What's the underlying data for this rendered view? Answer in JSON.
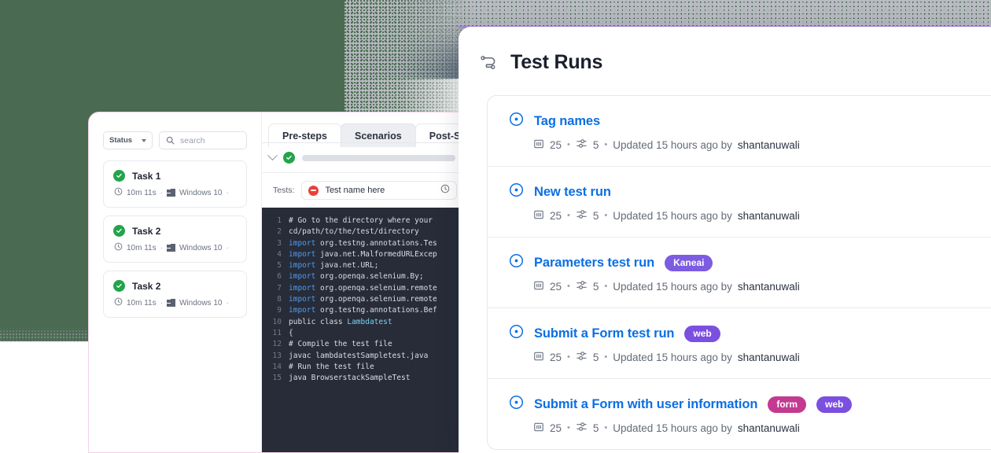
{
  "background": {
    "green": "#4a6b52",
    "slate": "#5d6a7d",
    "pink_line": "#f5cfe6",
    "purple_line": "#a78bd8"
  },
  "left_panel": {
    "filters": {
      "status_label": "Status",
      "search_placeholder": "search"
    },
    "tasks": [
      {
        "title": "Task 1",
        "duration": "10m 11s",
        "os": "Windows 10",
        "status": "passed"
      },
      {
        "title": "Task 2",
        "duration": "10m 11s",
        "os": "Windows 10",
        "status": "passed"
      },
      {
        "title": "Task 2",
        "duration": "10m 11s",
        "os": "Windows 10",
        "status": "passed"
      }
    ],
    "tabs": [
      {
        "label": "Pre-steps",
        "active": false
      },
      {
        "label": "Scenarios",
        "active": true
      },
      {
        "label": "Post-Steps",
        "active": false
      }
    ],
    "tests_row": {
      "label": "Tests:",
      "name": "Test name here",
      "status": "failed"
    },
    "code": {
      "lines": [
        {
          "n": "1",
          "text": "# Go to the directory where your"
        },
        {
          "n": "2",
          "text": "cd/path/to/the/test/directory"
        },
        {
          "n": "3",
          "kw": "import",
          "text": " org.testng.annotations.Tes"
        },
        {
          "n": "4",
          "kw": "import",
          "text": " java.net.MalformedURLExcep"
        },
        {
          "n": "5",
          "kw": "import",
          "text": " java.net.URL;"
        },
        {
          "n": "6",
          "kw": "import",
          "text": " org.openqa.selenium.By;"
        },
        {
          "n": "7",
          "kw": "import",
          "text": " org.openqa.selenium.remote"
        },
        {
          "n": "8",
          "kw": "import",
          "text": " org.openqa.selenium.remote"
        },
        {
          "n": "9",
          "kw": "import",
          "text": " org.testng.annotations.Bef"
        },
        {
          "n": "10",
          "text": "public class ",
          "cls": "Lambdatest"
        },
        {
          "n": "11",
          "text": "{"
        },
        {
          "n": "12",
          "text": "# Compile the test file"
        },
        {
          "n": "13",
          "text": "javac lambdatestSampletest.java"
        },
        {
          "n": "14",
          "text": "# Run the test file"
        },
        {
          "n": "15",
          "text": "java BrowserstackSampleTest"
        }
      ]
    }
  },
  "test_runs": {
    "title": "Test Runs",
    "items": [
      {
        "name": "Tag names",
        "tags": [],
        "cases": "25",
        "configs": "5",
        "updated": "Updated 15 hours ago by",
        "user": "shantanuwali"
      },
      {
        "name": "New test run",
        "tags": [],
        "cases": "25",
        "configs": "5",
        "updated": "Updated 15 hours ago by",
        "user": "shantanuwali"
      },
      {
        "name": "Parameters test run",
        "tags": [
          {
            "label": "Kaneai",
            "color": "#7c5ce0"
          }
        ],
        "cases": "25",
        "configs": "5",
        "updated": "Updated 15 hours ago by",
        "user": "shantanuwali"
      },
      {
        "name": "Submit a Form test run",
        "tags": [
          {
            "label": "web",
            "color": "#7b4fe0"
          }
        ],
        "cases": "25",
        "configs": "5",
        "updated": "Updated 15 hours ago by",
        "user": "shantanuwali"
      },
      {
        "name": "Submit a Form with user information",
        "tags": [
          {
            "label": "form",
            "color": "#c33a90"
          },
          {
            "label": "web",
            "color": "#7b4fe0"
          }
        ],
        "cases": "25",
        "configs": "5",
        "updated": "Updated 15 hours ago by",
        "user": "shantanuwali"
      }
    ]
  }
}
